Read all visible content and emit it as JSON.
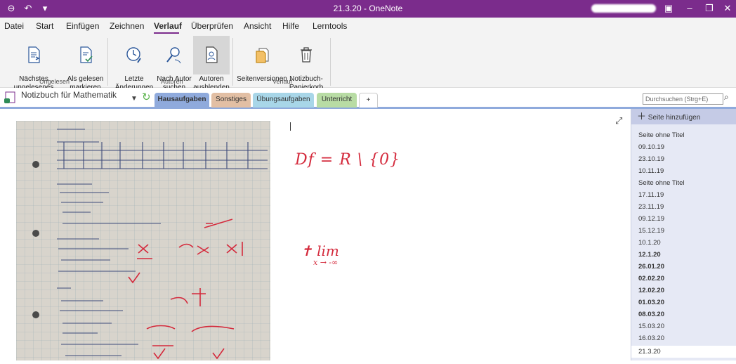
{
  "window": {
    "title": "21.3.20  -  OneNote"
  },
  "menu": [
    "Datei",
    "Start",
    "Einfügen",
    "Zeichnen",
    "Verlauf",
    "Überprüfen",
    "Ansicht",
    "Hilfe",
    "Lerntools"
  ],
  "ribbon": {
    "next_unread": "Nächstes\nungelesenes Element",
    "mark_read": "Als gelesen\nmarkieren",
    "recent_changes": "Letzte\nÄnderungen",
    "find_by_author": "Nach Autor\nsuchen",
    "hide_authors": "Autoren\nausblenden",
    "page_versions": "Seitenversionen",
    "recycle_bin": "Notizbuch-\nPapierkorb",
    "group_unread": "Ungelesen",
    "group_authors": "Autoren",
    "group_history": "Verlauf"
  },
  "notebook": {
    "name": "Notizbuch für Mathematik"
  },
  "sections": [
    "Hausaufgaben",
    "Sonstiges",
    "Übungsaufgaben",
    "Unterricht",
    "+"
  ],
  "search": {
    "placeholder": "Durchsuchen (Strg+E)"
  },
  "pages": {
    "add_label": "Seite hinzufügen",
    "items": [
      {
        "label": "Seite ohne Titel",
        "bold": false
      },
      {
        "label": "09.10.19",
        "bold": false
      },
      {
        "label": "23.10.19",
        "bold": false
      },
      {
        "label": "10.11.19",
        "bold": false
      },
      {
        "label": "Seite ohne Titel",
        "bold": false
      },
      {
        "label": "17.11.19",
        "bold": false
      },
      {
        "label": "23.11.19",
        "bold": false
      },
      {
        "label": "09.12.19",
        "bold": false
      },
      {
        "label": "15.12.19",
        "bold": false
      },
      {
        "label": "10.1.20",
        "bold": false
      },
      {
        "label": "12.1.20",
        "bold": true
      },
      {
        "label": "26.01.20",
        "bold": true
      },
      {
        "label": "02.02.20",
        "bold": true
      },
      {
        "label": "12.02.20",
        "bold": true
      },
      {
        "label": "01.03.20",
        "bold": true
      },
      {
        "label": "08.03.20",
        "bold": true
      },
      {
        "label": "15.03.20",
        "bold": false
      },
      {
        "label": "16.03.20",
        "bold": false
      }
    ],
    "selected": "21.3.20"
  },
  "ink": {
    "domain": "Df = R \\ {0}",
    "limit": "lim",
    "limit_sub": "x → -∞"
  },
  "colors": {
    "accent": "#7b2c8c",
    "ink_red": "#d42a3c"
  }
}
